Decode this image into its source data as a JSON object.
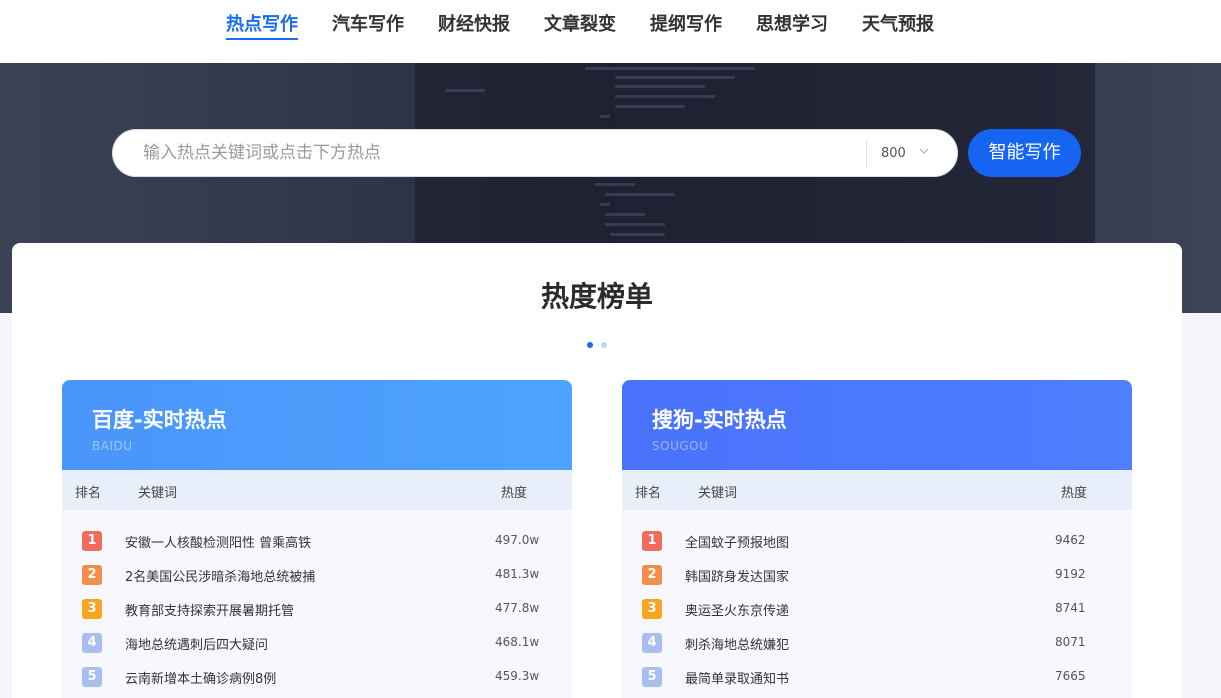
{
  "nav": {
    "items": [
      "热点写作",
      "汽车写作",
      "财经快报",
      "文章裂变",
      "提纲写作",
      "思想学习",
      "天气预报"
    ],
    "active": "热点写作"
  },
  "search": {
    "placeholder": "输入热点关键词或点击下方热点",
    "count_value": "800",
    "button_label": "智能写作"
  },
  "ranking": {
    "title": "热度榜单",
    "carousel_active_index": 0,
    "colors": {
      "accent": "#1565f2",
      "baidu_head": "#4b9dfd",
      "sougou_head": "#4b79fd",
      "rank1": "#f36b5e",
      "rank2": "#f68c4c",
      "rank3": "#f6a623",
      "rank_other": "#a9bef0"
    },
    "panels": [
      {
        "title": "百度-实时热点",
        "subtitle": "BAIDU",
        "columns": {
          "rank": "排名",
          "keyword": "关键词",
          "heat": "热度"
        },
        "rows": [
          {
            "rank": "1",
            "keyword": "安徽一人核酸检测阳性 曾乘高铁",
            "heat": "497.0w"
          },
          {
            "rank": "2",
            "keyword": "2名美国公民涉暗杀海地总统被捕",
            "heat": "481.3w"
          },
          {
            "rank": "3",
            "keyword": "教育部支持探索开展暑期托管",
            "heat": "477.8w"
          },
          {
            "rank": "4",
            "keyword": "海地总统遇刺后四大疑问",
            "heat": "468.1w"
          },
          {
            "rank": "5",
            "keyword": "云南新增本土确诊病例8例",
            "heat": "459.3w"
          }
        ]
      },
      {
        "title": "搜狗-实时热点",
        "subtitle": "SOUGOU",
        "columns": {
          "rank": "排名",
          "keyword": "关键词",
          "heat": "热度"
        },
        "rows": [
          {
            "rank": "1",
            "keyword": "全国蚊子预报地图",
            "heat": "9462"
          },
          {
            "rank": "2",
            "keyword": "韩国跻身发达国家",
            "heat": "9192"
          },
          {
            "rank": "3",
            "keyword": "奥运圣火东京传递",
            "heat": "8741"
          },
          {
            "rank": "4",
            "keyword": "刺杀海地总统嫌犯",
            "heat": "8071"
          },
          {
            "rank": "5",
            "keyword": "最简单录取通知书",
            "heat": "7665"
          }
        ]
      }
    ]
  }
}
